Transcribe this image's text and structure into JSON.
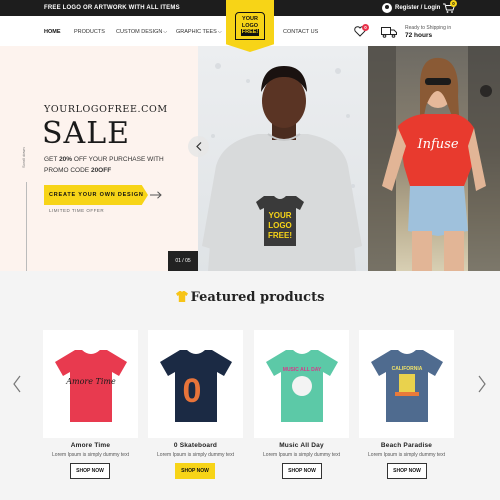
{
  "topbar": {
    "promo": "FREE LOGO OR ARTWORK WITH ALL ITEMS",
    "account_label": "Register / Login",
    "cart_count": "0"
  },
  "logo": {
    "line1": "YOUR",
    "line2": "LOGO",
    "line3": "FREE!"
  },
  "nav": {
    "items": [
      "HOME",
      "PRODUCTS",
      "CUSTOM DESIGN",
      "GRAPHIC TEES",
      "CONTACT US"
    ],
    "dropdown_icon": "⌵",
    "wishlist_count": "0",
    "shipping_line1": "Ready to Shipping in",
    "shipping_line2": "72 hours"
  },
  "hero": {
    "brand": "YOURLOGOFREE.COM",
    "headline": "SALE",
    "offer_pre": "GET ",
    "offer_pct": "20%",
    "offer_mid": " OFF YOUR PURCHASE WITH",
    "offer_line2": "PROMO CODE ",
    "offer_code": "20OFF",
    "cta": "CREATE YOUR OWN DESIGN",
    "limited": "LIMITED TIME OFFER",
    "scroll": "Scroll down",
    "counter": "01 / 05",
    "shirt1_text_1": "YOUR",
    "shirt1_text_2": "LOGO",
    "shirt1_text_3": "FREE!",
    "shirt2_text": "Infuse"
  },
  "featured": {
    "title": "Featured products",
    "products": [
      {
        "name": "Amore Time",
        "desc": "Lorem Ipsum is simply dummy text",
        "shop": "SHOP NOW",
        "color": "#e83a4f",
        "print": "Amore Time"
      },
      {
        "name": "0 Skateboard",
        "desc": "Lorem Ipsum is simply dummy text",
        "shop": "SHOP NOW",
        "color": "#1b2a44",
        "print": "0"
      },
      {
        "name": "Music All Day",
        "desc": "Lorem Ipsum is simply dummy text",
        "shop": "SHOP NOW",
        "color": "#5cc9a7",
        "print": "MUSIC ALL DAY"
      },
      {
        "name": "Beach Paradise",
        "desc": "Lorem Ipsum is simply dummy text",
        "shop": "SHOP NOW",
        "color": "#4f6b8f",
        "print": "CALIFORNIA"
      }
    ]
  },
  "colors": {
    "accent": "#f7d417",
    "dark": "#1d1d1d"
  }
}
